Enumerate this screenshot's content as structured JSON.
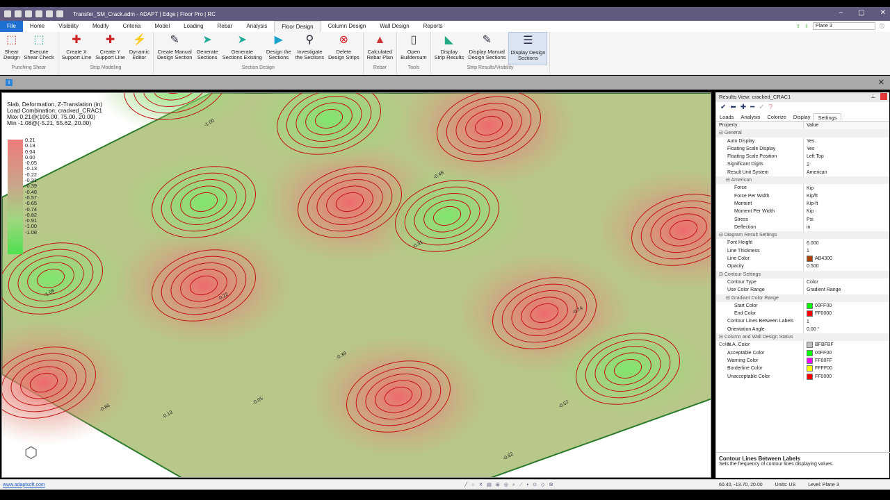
{
  "window": {
    "title": "Transfer_SM_Crack.adm - ADAPT | Edge | Floor Pro | RC"
  },
  "tabs": [
    "File",
    "Home",
    "Visibility",
    "Modify",
    "Criteria",
    "Model",
    "Loading",
    "Rebar",
    "Analysis",
    "Floor Design",
    "Column Design",
    "Wall Design",
    "Reports"
  ],
  "active_tab": "Floor Design",
  "plane_selector": "Plane 3",
  "ribbon": [
    {
      "group": "Punching Shear",
      "buttons": [
        "Shear\nDesign",
        "Execute\nShear Check"
      ]
    },
    {
      "group": "Strip Modeling",
      "buttons": [
        "Create X\nSupport Line",
        "Create Y\nSupport Line",
        "Dynamic\nEditor"
      ]
    },
    {
      "group": "Section Design",
      "buttons": [
        "Create Manual\nDesign Section",
        "Generate\nSections",
        "Generate\nSections Existing",
        "Design the\nSections",
        "Investigate\nthe Sections",
        "Delete\nDesign Strips"
      ]
    },
    {
      "group": "Rebar",
      "buttons": [
        "Calculated\nRebar Plan"
      ]
    },
    {
      "group": "Tools",
      "buttons": [
        "Open\nBuildersum"
      ]
    },
    {
      "group": "Strip Results/Visibility",
      "buttons": [
        "Display\nStrip Results",
        "Display Manual\nDesign Sections",
        "Display Design\nSections"
      ]
    }
  ],
  "viewport": {
    "header": [
      "Slab, Deformation, Z-Translation (in)",
      "Load Combination: cracked_CRAC1",
      "Max 0.21@(105.00, 75.00, 20.00)",
      "Min -1.08@(-5.21, 55.62, 20.00)"
    ],
    "scale": [
      "0.21",
      "0.13",
      "0.04",
      "0.00",
      "-0.05",
      "-0.13",
      "-0.22",
      "-0.31",
      "-0.39",
      "-0.48",
      "-0.57",
      "-0.65",
      "-0.74",
      "-0.82",
      "-0.91",
      "-1.00",
      "-1.08"
    ],
    "contour_labels": [
      "-1.00",
      "-0.48",
      "-0.31",
      "-0.22",
      "-1.08",
      "-0.74",
      "-0.39",
      "-0.13",
      "-0.05",
      "-0.57",
      "-0.65",
      "-0.82"
    ],
    "gradient_start": "#00FF00",
    "gradient_end": "#FF0000"
  },
  "panel": {
    "title": "Results View: cracked_CRAC1",
    "tabs": [
      "Loads",
      "Analysis",
      "Colorize",
      "Display",
      "Settings"
    ],
    "active_tab": "Settings",
    "col_property": "Property",
    "col_value": "Value",
    "rows": [
      {
        "t": "sec",
        "k": "General"
      },
      {
        "k": "Auto Display",
        "v": "Yes"
      },
      {
        "k": "Floating Scale Display",
        "v": "Yes"
      },
      {
        "k": "Floating Scale Position",
        "v": "Left Top"
      },
      {
        "k": "Significant Digits",
        "v": "2"
      },
      {
        "k": "Result Unit System",
        "v": "American"
      },
      {
        "t": "sub",
        "k": "American"
      },
      {
        "t": "l2",
        "k": "Force",
        "v": "Kip"
      },
      {
        "t": "l2",
        "k": "Force Per Width",
        "v": "Kip/ft"
      },
      {
        "t": "l2",
        "k": "Moment",
        "v": "Kip-ft"
      },
      {
        "t": "l2",
        "k": "Moment Per Width",
        "v": "Kip"
      },
      {
        "t": "l2",
        "k": "Stress",
        "v": "Psi"
      },
      {
        "t": "l2",
        "k": "Deflection",
        "v": "in"
      },
      {
        "t": "sec",
        "k": "Diagram Result Settings"
      },
      {
        "k": "Font Height",
        "v": "6.000"
      },
      {
        "k": "Line Thickness",
        "v": "1"
      },
      {
        "k": "Line Color",
        "v": "AB4300",
        "c": "#AB4300"
      },
      {
        "k": "Opacity",
        "v": "0.500"
      },
      {
        "t": "sec",
        "k": "Contour Settings"
      },
      {
        "k": "Contour Type",
        "v": "Color"
      },
      {
        "k": "Use Color Range",
        "v": "Gradient Range"
      },
      {
        "t": "sub",
        "k": "Gradiant Color Range"
      },
      {
        "t": "l2",
        "k": "Start Color",
        "v": "00FF00",
        "c": "#00FF00"
      },
      {
        "t": "l2",
        "k": "End Color",
        "v": "FF0000",
        "c": "#FF0000"
      },
      {
        "k": "Contour Lines Between Labels",
        "v": "1"
      },
      {
        "k": "Orientation Angle",
        "v": "0.00 °"
      },
      {
        "t": "sec",
        "k": "Column and Wall Design Status Color"
      },
      {
        "k": "N.A. Color",
        "v": "BFBFBF",
        "c": "#BFBFBF"
      },
      {
        "k": "Acceptable Color",
        "v": "00FF00",
        "c": "#00FF00"
      },
      {
        "k": "Warning Color",
        "v": "FF00FF",
        "c": "#FF00FF"
      },
      {
        "k": "Borderline Color",
        "v": "FFFF00",
        "c": "#FFFF00"
      },
      {
        "k": "Unacceptable Color",
        "v": "FF0000",
        "c": "#FF0000"
      }
    ],
    "help_title": "Contour Lines Between Labels",
    "help_text": "Sets the frequency of contour lines displaying values."
  },
  "status": {
    "link": "www.adaptsoft.com",
    "coords": "60.40, -13.70, 20.00",
    "units": "Units: US",
    "level": "Level: Plane 3"
  }
}
